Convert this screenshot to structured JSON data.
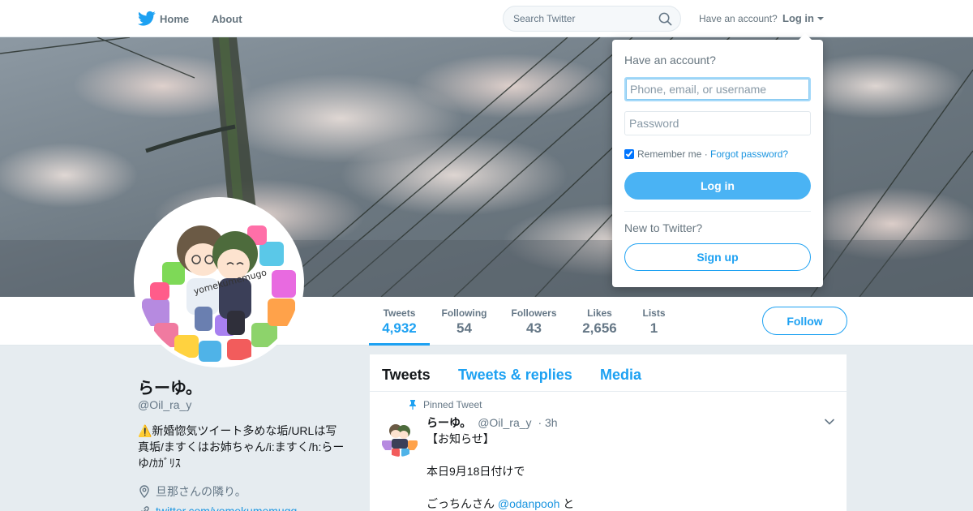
{
  "nav": {
    "home_label": "Home",
    "about_label": "About",
    "search_placeholder": "Search Twitter",
    "have_account": "Have an account?",
    "login_label": "Log in"
  },
  "login_dropdown": {
    "title": "Have an account?",
    "username_placeholder": "Phone, email, or username",
    "password_placeholder": "Password",
    "remember_label": "Remember me",
    "separator": " · ",
    "forgot_label": "Forgot password?",
    "login_button": "Log in",
    "new_prompt": "New to Twitter?",
    "signup_button": "Sign up"
  },
  "profile": {
    "name": "らーゆ。",
    "handle": "@Oil_ra_y",
    "bio_line1": "⚠️新婚惚気ツイート多めな垢/URLは写",
    "bio_line2": "真垢/ますくはお姉ちゃん/i:ますく/h:らー",
    "bio_line3": "ゆ/ｶｶﾞﾘｽ",
    "location": "旦那さんの隣り。",
    "url": "twitter.com/yomekumemugg"
  },
  "stats": [
    {
      "label": "Tweets",
      "value": "4,932"
    },
    {
      "label": "Following",
      "value": "54"
    },
    {
      "label": "Followers",
      "value": "43"
    },
    {
      "label": "Likes",
      "value": "2,656"
    },
    {
      "label": "Lists",
      "value": "1"
    }
  ],
  "follow_button": "Follow",
  "timeline": {
    "tabs": [
      "Tweets",
      "Tweets & replies",
      "Media"
    ],
    "pinned_label": "Pinned Tweet",
    "tweet": {
      "name": "らーゆ。",
      "handle": "@Oil_ra_y",
      "time": "· 3h",
      "line1": "【お知らせ】",
      "line2": "本日9月18日付けで",
      "line3_prefix": "ごっちんさん ",
      "line3_mention": "@odanpooh",
      "line3_suffix": " と"
    }
  },
  "avatar_text": "yomekumemugo",
  "colors": {
    "accent": "#1da1f2",
    "background": "#e6ecf0",
    "login_button": "#4ab3f4"
  }
}
